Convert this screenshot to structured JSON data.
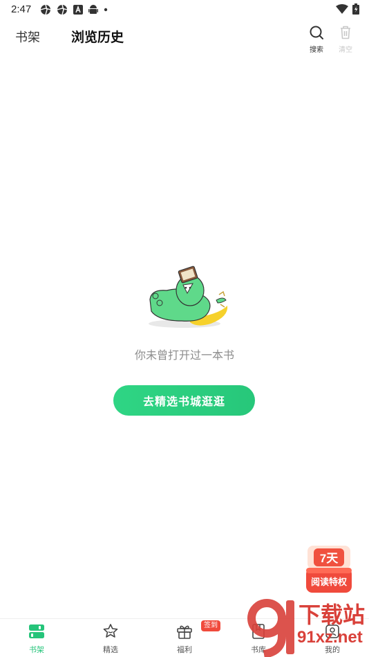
{
  "status_bar": {
    "time": "2:47",
    "icons": [
      "aperture-icon",
      "aperture-icon",
      "a-box-icon",
      "android-icon",
      "dot-icon"
    ],
    "right_icons": [
      "wifi-icon",
      "battery-icon"
    ]
  },
  "header": {
    "tab_shelf": "书架",
    "tab_history": "浏览历史",
    "search_label": "搜索",
    "clear_label": "清空"
  },
  "empty_state": {
    "message": "你未曾打开过一本书",
    "cta": "去精选书城逛逛"
  },
  "promo": {
    "days": "7天",
    "label": "阅读特权"
  },
  "bottom_nav": {
    "items": [
      {
        "label": "书架",
        "icon": "bookshelf-icon",
        "active": true
      },
      {
        "label": "精选",
        "icon": "star-chat-icon",
        "active": false
      },
      {
        "label": "福利",
        "icon": "gift-icon",
        "active": false
      },
      {
        "label": "书库",
        "icon": "book-icon",
        "active": false
      },
      {
        "label": "我的",
        "icon": "profile-icon",
        "active": false
      }
    ],
    "signin_badge": "签到"
  },
  "watermark": {
    "line1": "下载站",
    "line2": "91xz.net"
  },
  "colors": {
    "accent": "#25c47a",
    "badge_red": "#f04a3c",
    "muted_text": "#8d8d8d"
  }
}
